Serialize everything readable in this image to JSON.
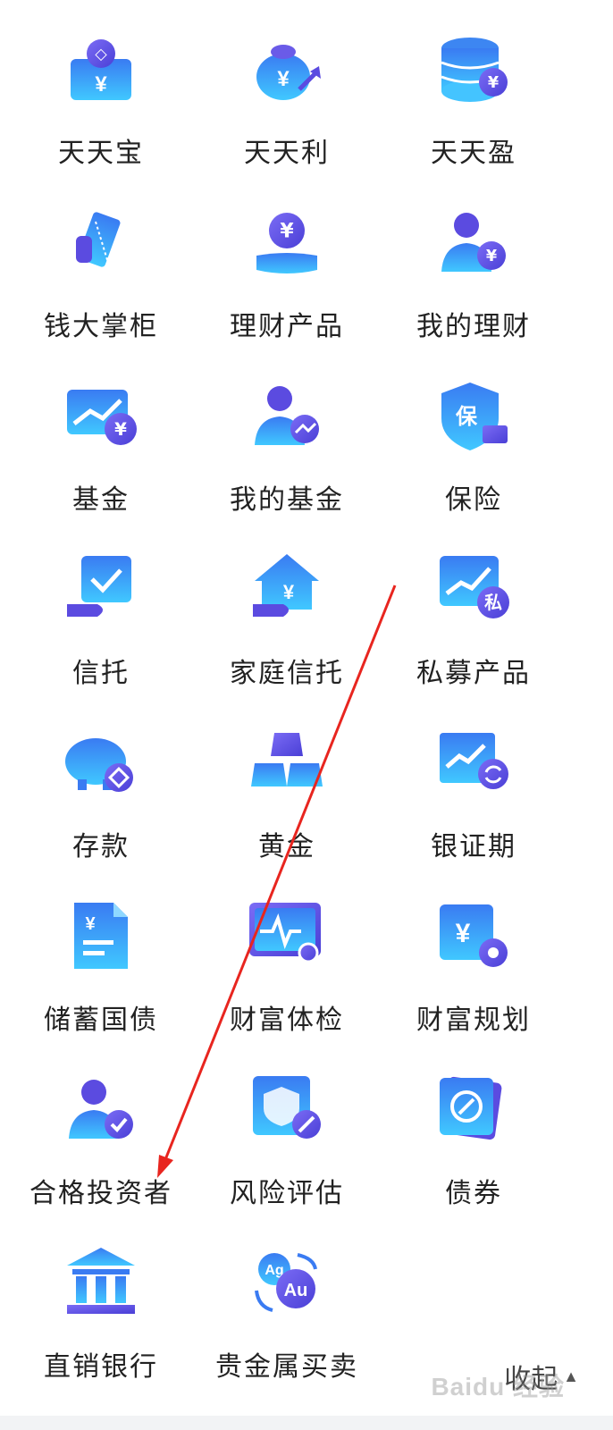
{
  "menu": {
    "items": [
      {
        "label": "天天宝",
        "icon": "coin-purse-icon"
      },
      {
        "label": "天天利",
        "icon": "money-bag-icon"
      },
      {
        "label": "天天盈",
        "icon": "coin-stack-icon"
      },
      {
        "label": "钱大掌柜",
        "icon": "hand-card-icon"
      },
      {
        "label": "理财产品",
        "icon": "hand-coin-icon"
      },
      {
        "label": "我的理财",
        "icon": "user-coin-icon"
      },
      {
        "label": "基金",
        "icon": "chart-coin-icon"
      },
      {
        "label": "我的基金",
        "icon": "user-chart-icon"
      },
      {
        "label": "保险",
        "icon": "shield-insurance-icon"
      },
      {
        "label": "信托",
        "icon": "hand-check-icon"
      },
      {
        "label": "家庭信托",
        "icon": "house-hand-icon"
      },
      {
        "label": "私募产品",
        "icon": "chart-private-icon"
      },
      {
        "label": "存款",
        "icon": "piggy-bank-icon"
      },
      {
        "label": "黄金",
        "icon": "gold-bars-icon"
      },
      {
        "label": "银证期",
        "icon": "chart-refresh-icon"
      },
      {
        "label": "储蓄国债",
        "icon": "bond-document-icon"
      },
      {
        "label": "财富体检",
        "icon": "monitor-search-icon"
      },
      {
        "label": "财富规划",
        "icon": "coin-gear-icon"
      },
      {
        "label": "合格投资者",
        "icon": "user-check-icon"
      },
      {
        "label": "风险评估",
        "icon": "shield-pen-icon"
      },
      {
        "label": "债券",
        "icon": "compass-card-icon"
      },
      {
        "label": "直销银行",
        "icon": "bank-building-icon"
      },
      {
        "label": "贵金属买卖",
        "icon": "ag-au-exchange-icon"
      }
    ]
  },
  "collapse_label": "收起",
  "watermark_text": "Baidu 经验",
  "colors": {
    "icon_blue": "#2f8cf0",
    "icon_light": "#5cc3ff",
    "icon_purple": "#5b4be0",
    "annotation_red": "#e8251f"
  }
}
